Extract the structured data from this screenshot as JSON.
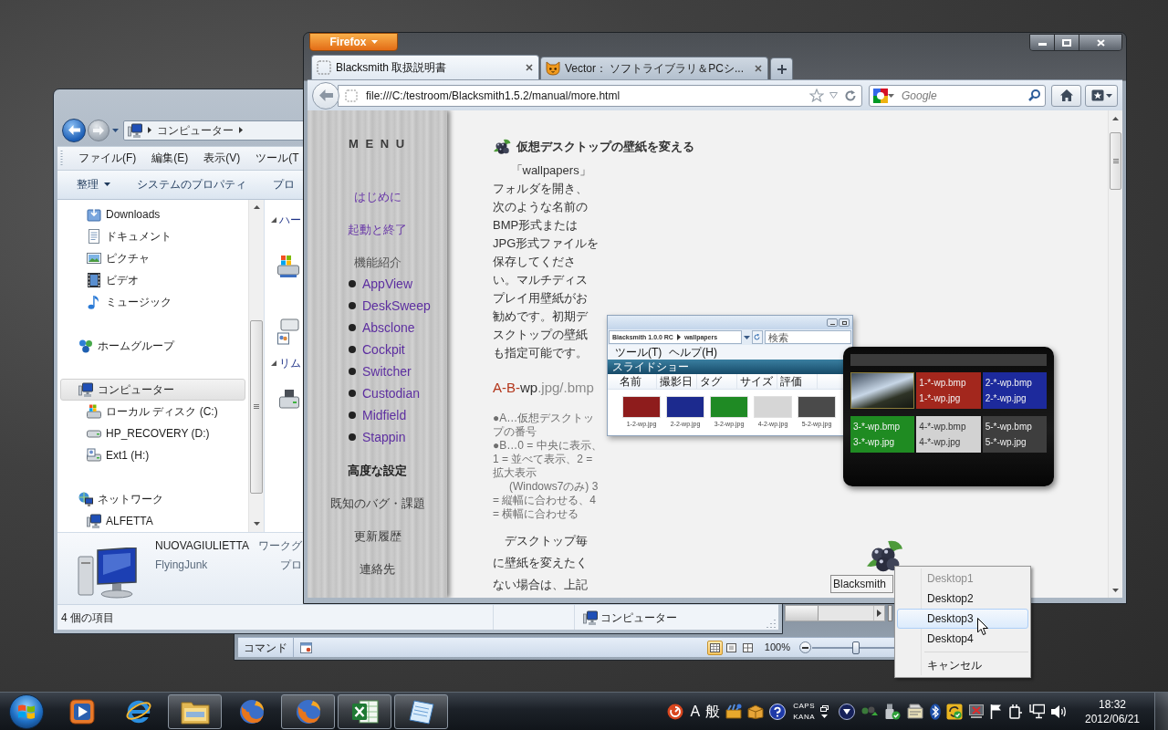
{
  "excel_window": {
    "status": "コマンド",
    "view_buttons": [
      {
        "selected": true
      },
      {
        "selected": false
      },
      {
        "selected": false
      }
    ],
    "zoom": {
      "reading": "100%",
      "level": 0.5
    }
  },
  "explorer_window": {
    "address": [
      "コンピューター"
    ],
    "menu": [
      "ファイル(F)",
      "編集(E)",
      "表示(V)",
      "ツール(T"
    ],
    "commands": [
      {
        "label": "整理",
        "dropdown": true
      },
      {
        "label": "システムのプロパティ",
        "dropdown": false
      },
      {
        "label": "プロ",
        "dropdown": false
      }
    ],
    "nav_pane": {
      "scrolled_group_items": [
        {
          "label": "Downloads",
          "selected": false
        },
        {
          "label": "ドキュメント",
          "selected": false
        },
        {
          "label": "ピクチャ",
          "selected": false
        },
        {
          "label": "ビデオ",
          "selected": false
        },
        {
          "label": "ミュージック",
          "selected": false
        }
      ],
      "groups": [
        {
          "label": "ホームグループ",
          "selected": false
        },
        {
          "label": "コンピューター",
          "selected": true,
          "children": [
            {
              "label": "ローカル ディスク (C:)",
              "selected": false
            },
            {
              "label": "HP_RECOVERY (D:)",
              "selected": false
            },
            {
              "label": "Ext1 (H:)",
              "selected": false
            }
          ]
        },
        {
          "label": "ネットワーク",
          "selected": false,
          "children": [
            {
              "label": "ALFETTA",
              "selected": false
            }
          ]
        }
      ]
    },
    "content_headers": [
      "ハー",
      "リム"
    ],
    "details": {
      "name": "NUOVAGIULIETTA",
      "user": "FlyingJunk",
      "labels": [
        "ワークグ",
        "プロ"
      ]
    },
    "status_bar": {
      "count": "4 個の項目",
      "location": "コンピューター"
    }
  },
  "firefox_window": {
    "menu_button": "Firefox",
    "tabs": [
      {
        "title": "Blacksmith 取扱説明書",
        "selected": true
      },
      {
        "title": "Vector： ソフトライブラリ＆PCシ...",
        "selected": false
      }
    ],
    "url": "file:///C:/testroom/Blacksmith1.5.2/manual/more.html",
    "search": {
      "placeholder": "Google"
    },
    "page": {
      "menu_title": "M E N U",
      "menu": [
        {
          "label": "はじめに",
          "kind": "link",
          "visited": true,
          "selected": false
        },
        {
          "label": "起動と終了",
          "kind": "link",
          "visited": true,
          "selected": false
        },
        {
          "label": "機能紹介",
          "kind": "label",
          "children": [
            {
              "label": "AppView",
              "visited": true,
              "selected": false
            },
            {
              "label": "DeskSweep",
              "visited": true,
              "selected": false
            },
            {
              "label": "Absclone",
              "visited": true,
              "selected": false
            },
            {
              "label": "Cockpit",
              "visited": true,
              "selected": false
            },
            {
              "label": "Switcher",
              "visited": true,
              "selected": false
            },
            {
              "label": "Custodian",
              "visited": true,
              "selected": false
            },
            {
              "label": "Midfield",
              "visited": true,
              "selected": false
            },
            {
              "label": "Stappin",
              "visited": true,
              "selected": false
            }
          ]
        },
        {
          "label": "高度な設定",
          "kind": "link",
          "selected": true
        },
        {
          "label": "既知のバグ・課題",
          "kind": "link",
          "visited": false,
          "selected": false
        },
        {
          "label": "更新履歴",
          "kind": "link",
          "visited": false,
          "selected": false
        },
        {
          "label": "連絡先",
          "kind": "link",
          "visited": false,
          "selected": false
        }
      ],
      "heading": "仮想デスクトップの壁紙を変える",
      "intro": "「wallpapers」フォルダを開き、次のような名前のBMP形式またはJPG形式ファイルを保存してください。マルチディスプレイ用壁紙がお勧めです。初期デスクトップの壁紙も指定可能です。",
      "filename_pattern": [
        {
          "text": "A-B-",
          "kind": "variable"
        },
        {
          "text": "wp",
          "kind": "fixed"
        },
        {
          "text": ".jpg/.bmp",
          "kind": "extension"
        }
      ],
      "notes": [
        {
          "text": "●A…仮想デスクトップの番号",
          "kind": "item"
        },
        {
          "text": "●B…0 = 中央に表示、1 = 並べて表示、2 = 拡大表示",
          "kind": "item"
        },
        {
          "text": "(Windows7のみ) 3 = 縦幅に合わせる、4 = 横幅に合わせる",
          "kind": "continuation"
        }
      ],
      "figure": {
        "explorer": {
          "path": [
            "Blacksmith 1.0.0 RC",
            "wallpapers"
          ],
          "search": {
            "placeholder": "検索"
          },
          "menu": [
            "ツール(T)",
            "ヘルプ(H)"
          ],
          "toolbar": "スライドショー",
          "columns": [
            "名前",
            "撮影日",
            "タグ",
            "サイズ",
            "評価"
          ],
          "files": [
            {
              "name": "1-2-wp.jpg",
              "color": "#8e1c1c"
            },
            {
              "name": "2-2-wp.jpg",
              "color": "#1c2a8e"
            },
            {
              "name": "3-2-wp.jpg",
              "color": "#1f8a24"
            },
            {
              "name": "4-2-wp.jpg",
              "color": "#d6d6d6"
            },
            {
              "name": "5-2-wp.jpg",
              "color": "#4a4a4a"
            }
          ]
        },
        "switcher": {
          "tiles": [
            {
              "kind": "photo"
            },
            {
              "kind": "wallpaper",
              "color": "#a3271d",
              "lines": [
                "1-*-wp.bmp",
                "1-*-wp.jpg"
              ]
            },
            {
              "kind": "wallpaper",
              "color": "#1d2a9c",
              "lines": [
                "2-*-wp.bmp",
                "2-*-wp.jpg"
              ]
            },
            {
              "kind": "wallpaper",
              "color": "#1f8b22",
              "lines": [
                "3-*-wp.bmp",
                "3-*-wp.jpg"
              ]
            },
            {
              "kind": "wallpaper",
              "color": "#d2d2d2",
              "lines": [
                "4-*-wp.bmp",
                "4-*-wp.jpg"
              ]
            },
            {
              "kind": "wallpaper",
              "color": "#3e3e3e",
              "lines": [
                "5-*-wp.bmp",
                "5-*-wp.jpg"
              ]
            }
          ]
        }
      },
      "outro": "デスクトップ毎に壁紙を変えたくない場合は、上記"
    }
  },
  "blacksmith_widget": {
    "label": "Blacksmith"
  },
  "context_menu": {
    "items": [
      {
        "kind": "item",
        "label": "Desktop1",
        "disabled": true,
        "selected": false
      },
      {
        "kind": "item",
        "label": "Desktop2",
        "disabled": false,
        "selected": false
      },
      {
        "kind": "item",
        "label": "Desktop3",
        "disabled": false,
        "selected": true
      },
      {
        "kind": "item",
        "label": "Desktop4",
        "disabled": false,
        "selected": false
      },
      {
        "kind": "separator"
      },
      {
        "kind": "item",
        "label": "キャンセル",
        "disabled": false,
        "selected": false
      }
    ]
  },
  "taskbar": {
    "buttons": [
      {
        "running": false
      },
      {
        "running": false
      },
      {
        "running": true
      },
      {
        "running": false
      },
      {
        "running": true
      },
      {
        "running": true
      },
      {
        "running": true
      }
    ],
    "ime": {
      "mode": "A",
      "dictionary": "般"
    },
    "lock_keys": [
      "CAPS",
      "KANA"
    ],
    "clock": {
      "time": "18:32",
      "date": "2012/06/21"
    }
  }
}
